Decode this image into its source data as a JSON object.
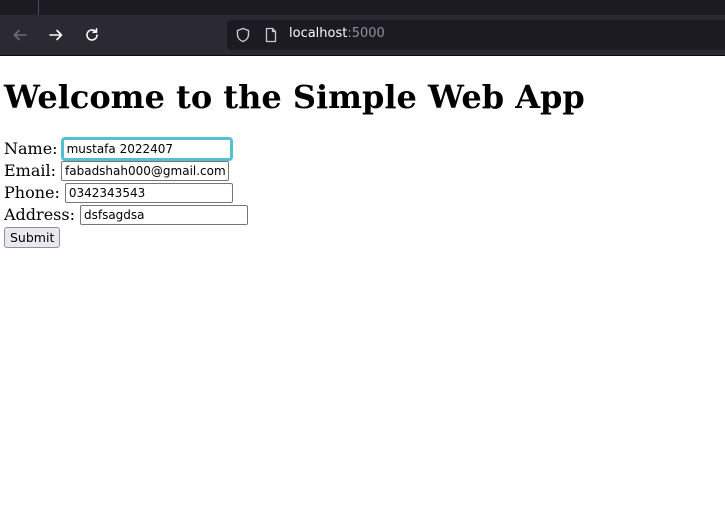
{
  "browser": {
    "url_host": "localhost",
    "url_port": ":5000",
    "icons": [
      "back-arrow-icon",
      "forward-arrow-icon",
      "reload-icon",
      "shield-icon",
      "page-icon"
    ]
  },
  "page": {
    "heading": "Welcome to the Simple Web App",
    "form": {
      "name_label": "Name:",
      "name_value": "mustafa 2022407",
      "email_label": "Email:",
      "email_value": "fabadshah000@gmail.com",
      "phone_label": "Phone:",
      "phone_value": "0342343543",
      "address_label": "Address:",
      "address_value": "dsfsagdsa",
      "submit_label": "Submit"
    }
  },
  "colors": {
    "toolbar": "#2b2a33",
    "urlbar": "#1c1b22",
    "focus_ring": "#54bfd0"
  }
}
